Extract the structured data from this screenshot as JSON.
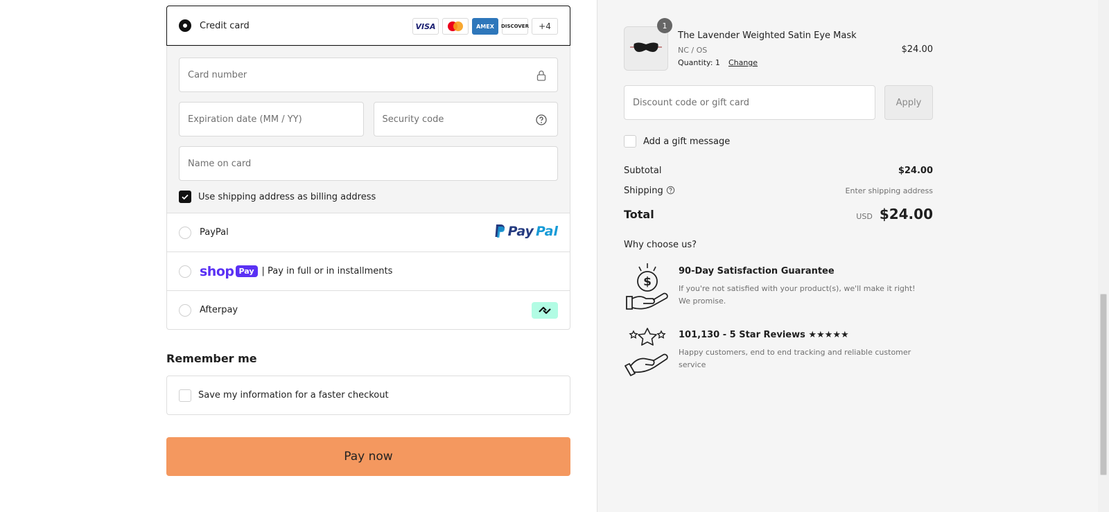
{
  "payment": {
    "credit_card_label": "Credit card",
    "card_logos": {
      "visa": "VISA",
      "amex": "AMEX",
      "discover": "DISCOVER",
      "more": "+4"
    },
    "card_number_placeholder": "Card number",
    "expiration_placeholder": "Expiration date (MM / YY)",
    "security_code_placeholder": "Security code",
    "name_on_card_placeholder": "Name on card",
    "billing_checkbox_label": "Use shipping address as billing address",
    "billing_checked": true,
    "paypal_label": "PayPal",
    "paypal_logo": {
      "part1": "Pay",
      "part2": "Pal"
    },
    "shop_logo": "shop",
    "shop_pay_badge": "Pay",
    "shop_pay_label": "| Pay in full or in installments",
    "afterpay_label": "Afterpay"
  },
  "remember": {
    "title": "Remember me",
    "checkbox_label": "Save my information for a faster checkout"
  },
  "pay_now_label": "Pay now",
  "summary": {
    "product": {
      "name": "The Lavender Weighted Satin Eye Mask",
      "variant": "NC / OS",
      "quantity_text": "Quantity: 1",
      "change_label": "Change",
      "price": "$24.00",
      "badge_count": "1"
    },
    "discount_placeholder": "Discount code or gift card",
    "apply_label": "Apply",
    "gift_message_label": "Add a gift message",
    "subtotal_label": "Subtotal",
    "subtotal_value": "$24.00",
    "shipping_label": "Shipping",
    "shipping_value": "Enter shipping address",
    "total_label": "Total",
    "total_currency": "USD",
    "total_value": "$24.00",
    "why_title": "Why choose us?",
    "features": [
      {
        "title": "90-Day Satisfaction Guarantee",
        "description": "If you're not satisfied with your product(s), we'll make it right! We promise."
      },
      {
        "title": "101,130 - 5 Star Reviews ★★★★★",
        "description": "Happy customers, end to end tracking and reliable customer service"
      }
    ]
  },
  "colors": {
    "pay_button": "#f4985f",
    "shop_pay": "#5a31f4",
    "paypal_dark": "#253b80",
    "paypal_light": "#179bd7",
    "afterpay": "#b2fce4"
  }
}
